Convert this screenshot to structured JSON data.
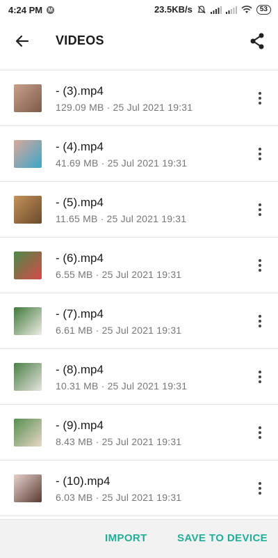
{
  "status_bar": {
    "time": "4:24 PM",
    "notif_icon_letter": "M",
    "speed": "23.5KB/s",
    "battery": "53"
  },
  "header": {
    "title": "VIDEOS",
    "back_icon": "arrow-left-icon",
    "share_icon": "share-icon"
  },
  "items": [
    {
      "name": "- (3).mp4",
      "meta": "129.09 MB · 25 Jul 2021 19:31",
      "thumb_colors": [
        "#c9a08a",
        "#7c5a4a"
      ]
    },
    {
      "name": "- (4).mp4",
      "meta": "41.69 MB · 25 Jul 2021 19:31",
      "thumb_colors": [
        "#d9a89a",
        "#3aa6c8"
      ]
    },
    {
      "name": "- (5).mp4",
      "meta": "11.65 MB · 25 Jul 2021 19:31",
      "thumb_colors": [
        "#c4925a",
        "#6b4a2c"
      ]
    },
    {
      "name": "- (6).mp4",
      "meta": "6.55 MB · 25 Jul 2021 19:31",
      "thumb_colors": [
        "#4c8a4a",
        "#d64848"
      ]
    },
    {
      "name": "- (7).mp4",
      "meta": "6.61 MB · 25 Jul 2021 19:31",
      "thumb_colors": [
        "#3f7a3c",
        "#f0ece6"
      ]
    },
    {
      "name": "- (8).mp4",
      "meta": "10.31 MB · 25 Jul 2021 19:31",
      "thumb_colors": [
        "#4a8047",
        "#e8e4de"
      ]
    },
    {
      "name": "- (9).mp4",
      "meta": "8.43 MB · 25 Jul 2021 19:31",
      "thumb_colors": [
        "#568f4f",
        "#e9d7c9"
      ]
    },
    {
      "name": "- (10).mp4",
      "meta": "6.03 MB · 25 Jul 2021 19:31",
      "thumb_colors": [
        "#e7d2cc",
        "#5a3a34"
      ]
    }
  ],
  "footer": {
    "import_label": "IMPORT",
    "save_label": "SAVE TO DEVICE"
  },
  "colors": {
    "accent": "#1fae9a",
    "divider": "#e0e0e0",
    "meta_text": "#777777"
  }
}
